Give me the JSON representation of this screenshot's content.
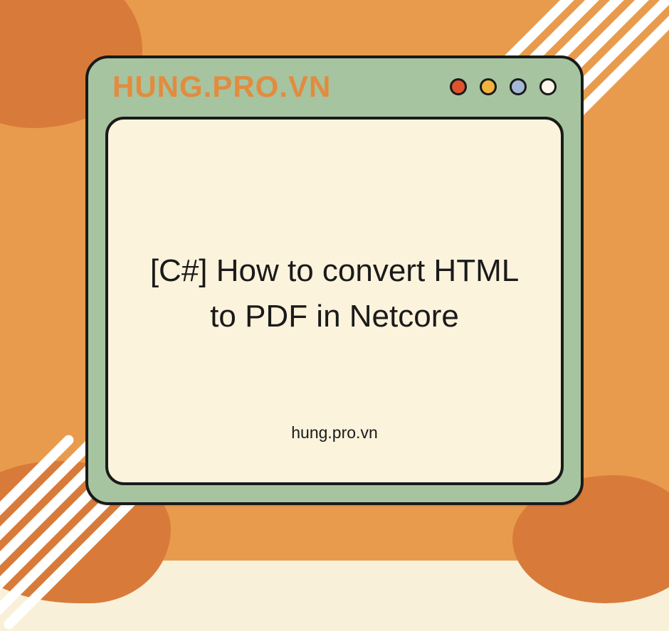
{
  "window": {
    "title": "HUNG.PRO.VN",
    "dots": [
      "red",
      "yellow",
      "blue",
      "white"
    ]
  },
  "content": {
    "headline": "[C#] How to convert HTML to PDF in Netcore",
    "footer": "hung.pro.vn"
  },
  "colors": {
    "accent": "#E38B3E",
    "window_bg": "#A6C4A0",
    "content_bg": "#FBF3DC",
    "page_bg": "#F9F0D9",
    "orange_panel": "#E89B4C",
    "blob": "#D87B3A",
    "stroke": "#1a1a1a"
  }
}
